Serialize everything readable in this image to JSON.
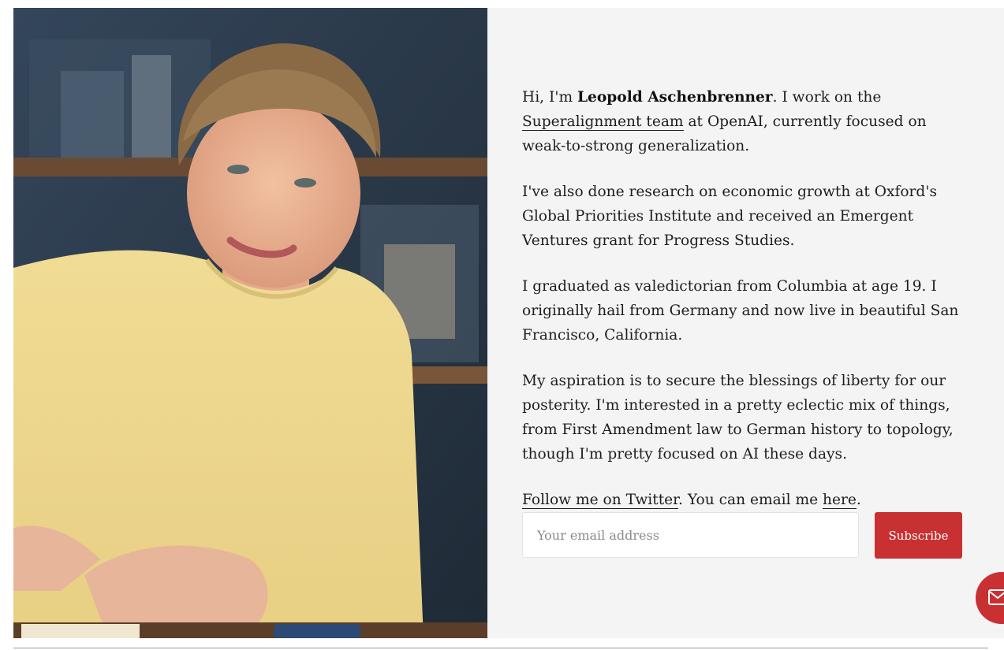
{
  "bio": {
    "p1_pre": "Hi, I'm ",
    "name": "Leopold Aschenbrenner",
    "p1_mid": ". I work on the ",
    "team_link": "Superalignment team",
    "p1_post": " at OpenAI, currently focused on weak-to-strong generalization.",
    "p2": "I've also done research on economic growth at Oxford's Global Priorities Institute and received an Emergent Ventures grant for Progress Studies.",
    "p3": "I graduated as valedictorian from Columbia at age 19. I originally hail from Germany and now live in beautiful San Francisco, California.",
    "p4": "My aspiration is to secure the blessings of liberty for our posterity. I'm interested in a pretty eclectic mix of things, from First Amendment law to German history to topology, though I'm pretty focused on AI these days.",
    "twitter_link": "Follow me on Twitter",
    "p5_mid": ". You can email me ",
    "email_link": "here",
    "p5_post": "."
  },
  "subscribe": {
    "placeholder": "Your email address",
    "button_label": "Subscribe"
  },
  "icons": {
    "fab": "mail-icon"
  },
  "colors": {
    "accent": "#c93032",
    "panel_bg": "#f4f4f4"
  }
}
